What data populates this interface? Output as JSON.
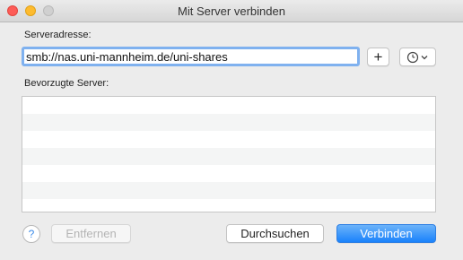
{
  "window": {
    "title": "Mit Server verbinden"
  },
  "server_address": {
    "label": "Serveradresse:",
    "value": "smb://nas.uni-mannheim.de/uni-shares"
  },
  "toolbar": {
    "add_label": "+",
    "history_icon": "clock-icon",
    "history_chevron": "chevron-down-icon"
  },
  "favorites": {
    "label": "Bevorzugte Server:",
    "items": []
  },
  "footer": {
    "help_label": "?",
    "remove_label": "Entfernen",
    "browse_label": "Durchsuchen",
    "connect_label": "Verbinden"
  },
  "colors": {
    "accent": "#1a82fb",
    "focus_ring": "#7fb1ef",
    "close": "#fd5c57",
    "minimize": "#fdbb2f"
  }
}
